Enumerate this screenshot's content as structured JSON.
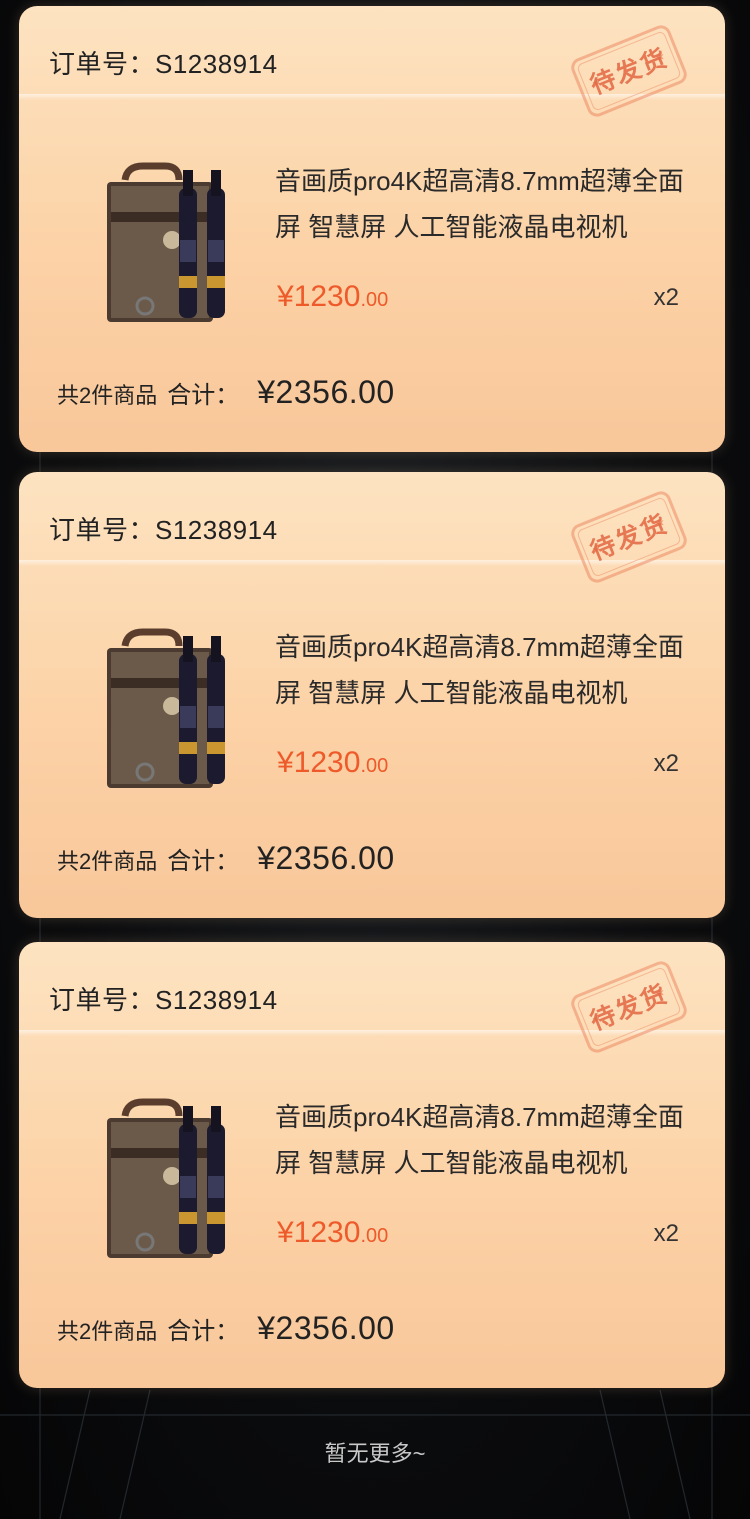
{
  "orders": [
    {
      "order_no": "订单号：S1238914",
      "status_stamp": "待发货",
      "product_title": "音画质pro4K超高清8.7mm超薄全面屏 智慧屏 人工智能液晶电视机",
      "price_currency": "¥",
      "price_int": "1230",
      "price_dec": ".00",
      "quantity": "x2",
      "item_count": "共2件商品",
      "total_label": "合计：",
      "total_amount": "¥2356.00"
    },
    {
      "order_no": "订单号：S1238914",
      "status_stamp": "待发货",
      "product_title": "音画质pro4K超高清8.7mm超薄全面屏 智慧屏 人工智能液晶电视机",
      "price_currency": "¥",
      "price_int": "1230",
      "price_dec": ".00",
      "quantity": "x2",
      "item_count": "共2件商品",
      "total_label": "合计：",
      "total_amount": "¥2356.00"
    },
    {
      "order_no": "订单号：S1238914",
      "status_stamp": "待发货",
      "product_title": "音画质pro4K超高清8.7mm超薄全面屏 智慧屏 人工智能液晶电视机",
      "price_currency": "¥",
      "price_int": "1230",
      "price_dec": ".00",
      "quantity": "x2",
      "item_count": "共2件商品",
      "total_label": "合计：",
      "total_amount": "¥2356.00"
    }
  ],
  "footer": {
    "no_more_text": "暂无更多~"
  },
  "colors": {
    "price": "#ee5a2a",
    "card_top": "#fde3c1",
    "card_bottom": "#f8c79a",
    "stamp": "#e26642"
  }
}
